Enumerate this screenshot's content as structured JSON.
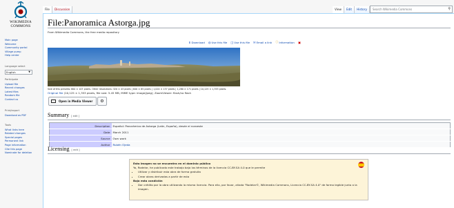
{
  "logo": {
    "text_line1": "WIKIMEDIA",
    "text_line2": "COMMONS"
  },
  "sidebar": {
    "nav_items": [
      "Main page",
      "Welcome",
      "Community portal",
      "Village pump",
      "Help center"
    ],
    "language_heading": "Language select",
    "language_value": "English",
    "participate_heading": "Participate",
    "participate_items": [
      "Upload file",
      "Recent changes",
      "Latest files",
      "Random file",
      "Contact us"
    ],
    "print_heading": "Print/export",
    "print_items": [
      "Download as PDF"
    ],
    "tools_heading": "Tools",
    "tools_items": [
      "What links here",
      "Related changes",
      "Special pages",
      "Permanent link",
      "Page information",
      "Cite this page",
      "Nominate for deletion"
    ]
  },
  "tabs": {
    "file": "File",
    "discussion": "Discussion",
    "view": "View",
    "edit": "Edit",
    "history": "History"
  },
  "search": {
    "placeholder": "Search Wikimedia Commons"
  },
  "page": {
    "title": "File:Panoramica Astorga.jpg",
    "site_sub": "From Wikimedia Commons, the free media repository"
  },
  "toolbar": {
    "download": "Download",
    "use_file_1": "Use this file",
    "use_file_2": "Use this file",
    "email_link": "Email a link",
    "information": "Information"
  },
  "file": {
    "sizes_line": "Size of this preview: 800 × 107 pixels. Other resolutions: 320 × 43 pixels | 640 × 85 pixels | 1,024 × 137 pixels | 1,280 × 171 pixels | 10,125 × 1,353 pixels.",
    "original_file": "Original file",
    "original_details": "(10,125 × 1,353 pixels, file size: 5.45 MB, MIME type: image/jpeg); ZoomViewer: flash/no flash",
    "media_viewer_label": "Open in Media Viewer"
  },
  "summary": {
    "heading": "Summary",
    "edit_label": "[ edit ]",
    "rows": [
      {
        "label": "Description",
        "value": "Español: Panorámica de Astorga (León, España), desde el noroeste"
      },
      {
        "label": "Date",
        "value": "March 2011"
      },
      {
        "label": "Source",
        "value": "Own work"
      },
      {
        "label": "Author",
        "value": "Rubén Ojeda"
      }
    ]
  },
  "licensing": {
    "heading": "Licensing",
    "edit_label": "[ edit ]",
    "box_title": "Esta imagen no se encuentra en el dominio público",
    "box_intro": "Yo, Rodelar, he publicado este trabajo bajo los términos de la licencia CC-BY-SA 4.0 que le permite",
    "bullets_1": [
      "Utilizar y distribuir esta obra de forma gratuita",
      "Crear obras derivadas a partir de esta"
    ],
    "condition_title": "Bajo esta condición",
    "bullets_2": [
      "Dar crédito por la obra utilizando la misma licencia. Para ello, por favor, añada \"Rodelar©, Wikimedia Commons, Licencia CC-BY-SA 4.0\" de forma legible junto a la imagen."
    ]
  }
}
